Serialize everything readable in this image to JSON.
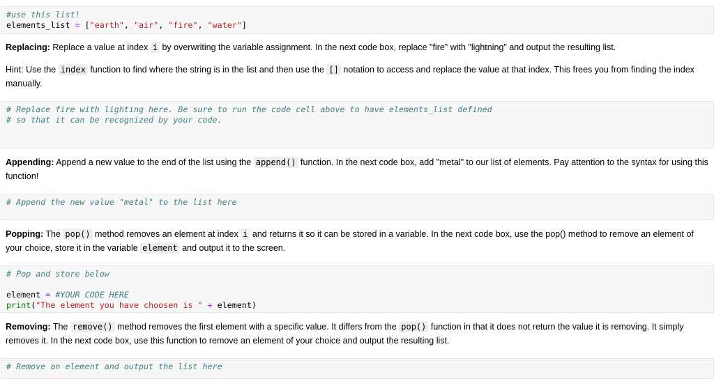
{
  "cell1": {
    "comment": "#use this list!",
    "var": "elements_list",
    "eq": " = ",
    "lb": "[",
    "s1": "\"earth\"",
    "s2": "\"air\"",
    "s3": "\"fire\"",
    "s4": "\"water\"",
    "sep": ", ",
    "rb": "]"
  },
  "md1": {
    "bold": "Replacing:",
    "t1": " Replace a value at index ",
    "code1": "i",
    "t2": " by overwriting the variable assignment. In the next code box, replace \"fire\" with \"lightning\" and output the resulting list."
  },
  "md1b": {
    "t1": "Hint: Use the ",
    "code1": "index",
    "t2": " function to find where the string is in the list and then use the ",
    "code2": "[]",
    "t3": " notation to access and replace the value at that index. This frees you from finding the index manually."
  },
  "cell2": {
    "line1": "# Replace fire with lighting here. Be sure to run the code cell above to have elements_list defined",
    "line2": "# so that it can be recognized by your code."
  },
  "md2": {
    "bold": "Appending:",
    "t1": " Append a new value to the end of the list using the ",
    "code1": "append()",
    "t2": " function. In the next code box, add \"metal\" to our list of elements. Pay attention to the syntax for using this function!"
  },
  "cell3": {
    "line1": "# Append the new value \"metal\" to the list here"
  },
  "md3": {
    "bold": "Popping:",
    "t1": " The ",
    "code1": "pop()",
    "t2": " method removes an element at index ",
    "code2": "i",
    "t3": " and returns it so it can be stored in a variable. In the next code box, use the pop() method to remove an element of your choice, store it in the variable ",
    "code3": "element",
    "t4": " and output it to the screen."
  },
  "cell4": {
    "line1": "# Pop and store below",
    "var": "element",
    "eq": " = ",
    "ph": "#YOUR CODE HERE",
    "fn": "print",
    "lp": "(",
    "str": "\"The element you have choosen is \"",
    "plus": " + ",
    "arg": "element)"
  },
  "md4": {
    "bold": "Removing:",
    "t1": " The ",
    "code1": "remove()",
    "t2": " method removes the first element with a specific value. It differs from the ",
    "code2": "pop()",
    "t3": " function in that it does not return the value it is removing. It simply removes it. In the next code box, use this function to remove an element of your choice and output the resulting list."
  },
  "cell5": {
    "line1": "# Remove an element and output the list here"
  }
}
